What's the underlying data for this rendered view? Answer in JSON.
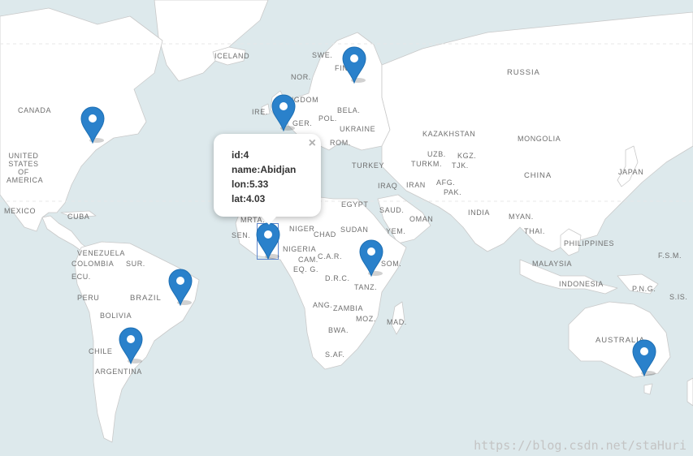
{
  "map": {
    "labels": {
      "iceland": "ICELAND",
      "swe": "SWE.",
      "fin": "FIN.",
      "nor": "NOR.",
      "russia": "RUSSIA",
      "canada": "CANADA",
      "ire": "IRE.",
      "kingdom": "KINGDOM",
      "bela": "BELA.",
      "pol": "POL.",
      "ger": "GER.",
      "ukraine": "UKRAINE",
      "kazakhstan": "KAZAKHSTAN",
      "mongolia": "MONGOLIA",
      "rom": "ROM.",
      "uzb": "UZB.",
      "kgz": "KGZ.",
      "turkm": "TURKM.",
      "tjk": "TJK.",
      "united_states": "UNITED STATES OF AMERICA",
      "turkey": "TURKEY",
      "china": "CHINA",
      "japan": "JAPAN",
      "iraq": "IRAQ",
      "iran": "IRAN",
      "afg": "AFG.",
      "pak": "PAK.",
      "mexico": "MEXICO",
      "cuba": "CUBA",
      "egypt": "EGYPT",
      "saud": "SAUD.",
      "oman": "OMAN",
      "india": "INDIA",
      "myan": "MYAN.",
      "thai": "THAI.",
      "mrta": "MRTA.",
      "niger": "NIGER",
      "sudan": "SUDAN",
      "yem": "YEM.",
      "philippines": "PHILIPPINES",
      "venezuela": "VENEZUELA",
      "sen": "SEN.",
      "chad": "CHAD",
      "colombia": "COLOMBIA",
      "sur": "SUR.",
      "nigeria": "NIGERIA",
      "car": "C.A.R.",
      "som": "SOM.",
      "malaysia": "MALAYSIA",
      "fsm": "F.S.M.",
      "ecu": "ECU.",
      "cam": "CAM.",
      "eqg": "EQ. G.",
      "drc": "D.R.C.",
      "indonesia": "INDONESIA",
      "png": "P.N.G.",
      "peru": "PERU",
      "brazil": "BRAZIL",
      "tanz": "TANZ.",
      "si": "S.IS.",
      "ang": "ANG.",
      "zambia": "ZAMBIA",
      "bolivia": "BOLIVIA",
      "moz": "MOZ.",
      "mad": "MAD.",
      "bwa": "BWA.",
      "australia": "AUSTRALIA",
      "chile": "CHILE",
      "sa": "S.AF.",
      "argentina": "ARGENTINA"
    },
    "markers": [
      {
        "name": "marker-usa"
      },
      {
        "name": "marker-uk"
      },
      {
        "name": "marker-finland"
      },
      {
        "name": "marker-abidjan"
      },
      {
        "name": "marker-kenya"
      },
      {
        "name": "marker-brazil"
      },
      {
        "name": "marker-argentina"
      },
      {
        "name": "marker-australia"
      }
    ],
    "marker_color": "#2a81cb"
  },
  "popup": {
    "line1": "id:4",
    "line2": "name:Abidjan",
    "line3": "lon:5.33",
    "line4": "lat:4.03",
    "close": "×"
  },
  "watermark": "https://blog.csdn.net/staHuri"
}
